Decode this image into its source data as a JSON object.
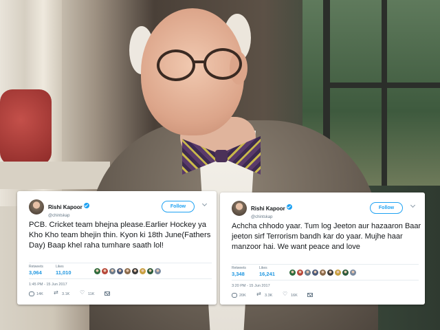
{
  "tweets": [
    {
      "author": {
        "name": "Rishi Kapoor",
        "handle": "@chintskap",
        "verified": true
      },
      "follow_label": "Follow",
      "text": "PCB. Cricket team bhejna please.Earlier Hockey ya Kho Kho team bhejin thin. Kyon ki 18th June(Fathers Day) Baap khel raha tumhare saath lol!",
      "retweets_label": "Retweets",
      "retweets": "3,064",
      "likes_label": "Likes",
      "likes": "11,010",
      "timestamp": "1:45 PM - 15 Jun 2017",
      "actions": {
        "replies": "14K",
        "retweets": "3.1K",
        "likes": "11K"
      }
    },
    {
      "author": {
        "name": "Rishi Kapoor",
        "handle": "@chintskap",
        "verified": true
      },
      "follow_label": "Follow",
      "text": "Achcha chhodo yaar. Tum log Jeeton aur hazaaron Baar jeeton sirf Terrorism bandh kar do yaar. Mujhe haar manzoor hai. We want peace and love",
      "retweets_label": "Retweets",
      "retweets": "3,348",
      "likes_label": "Likes",
      "likes": "16,241",
      "timestamp": "3:20 PM - 15 Jun 2017",
      "actions": {
        "replies": "20K",
        "retweets": "3.3K",
        "likes": "16K"
      }
    }
  ],
  "colors": {
    "twitter_blue": "#1da1f2",
    "stat_blue": "#1b95e0",
    "muted": "#657786",
    "text": "#14171a",
    "liker_avatars": [
      "#2e6b3c",
      "#b7473a",
      "#6a7a8a",
      "#4a5a7a",
      "#8a6a4a",
      "#3a3a3a",
      "#c8a040",
      "#2a5a3a",
      "#7a8aa0"
    ]
  },
  "icons": [
    "verified-badge-icon",
    "chevron-down-icon",
    "reply-icon",
    "retweet-icon",
    "heart-icon",
    "direct-message-icon"
  ]
}
